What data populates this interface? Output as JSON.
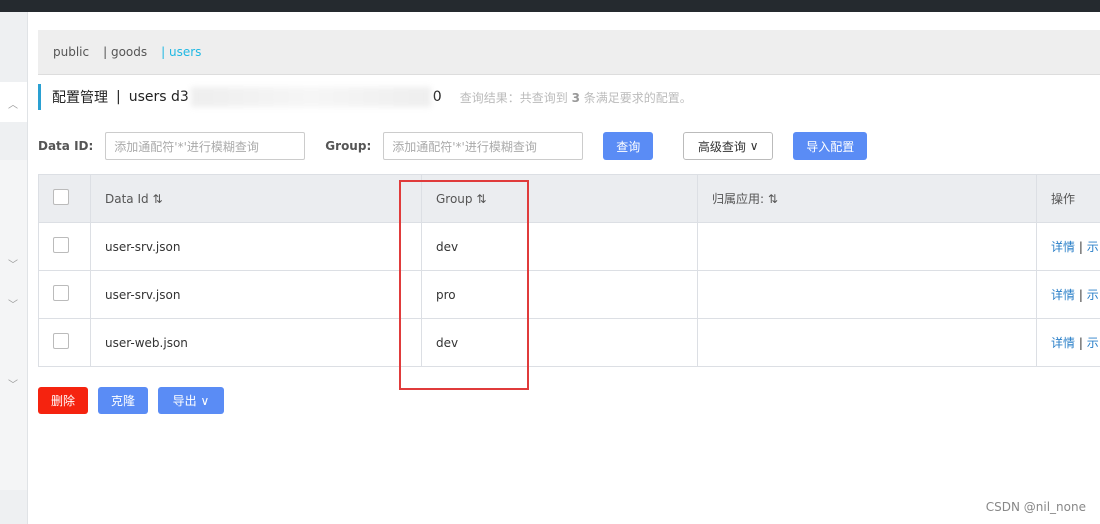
{
  "namespaces": [
    {
      "label": "public"
    },
    {
      "label": "| goods"
    },
    {
      "label": "| users",
      "active": true
    }
  ],
  "header": {
    "title": "配置管理",
    "sep": "|",
    "namespace": "users d3",
    "namespace_tail": "0",
    "result_prefix": "查询结果：共查询到",
    "result_count": "3",
    "result_suffix": "条满足要求的配置。"
  },
  "search": {
    "data_id_label": "Data ID:",
    "data_id_placeholder": "添加通配符'*'进行模糊查询",
    "group_label": "Group:",
    "group_placeholder": "添加通配符'*'进行模糊查询",
    "query_button": "查询",
    "advanced_button": "高级查询",
    "import_button": "导入配置"
  },
  "table": {
    "headers": [
      "Data Id ⇅",
      "Group ⇅",
      "归属应用: ⇅",
      "操作"
    ],
    "rows": [
      {
        "data_id": "user-srv.json",
        "group": "dev",
        "app": ""
      },
      {
        "data_id": "user-srv.json",
        "group": "pro",
        "app": ""
      },
      {
        "data_id": "user-web.json",
        "group": "dev",
        "app": ""
      }
    ],
    "action_detail": "详情",
    "action_sep": "|",
    "action_more": "示"
  },
  "actions": {
    "delete": "删除",
    "clone": "克隆",
    "export": "导出"
  },
  "watermark": "CSDN @nil_none",
  "colors": {
    "accent": "#5a8cf5",
    "danger": "#f5230f",
    "active_ns": "#1fb8e3",
    "highlight_box": "#e03b3b"
  }
}
